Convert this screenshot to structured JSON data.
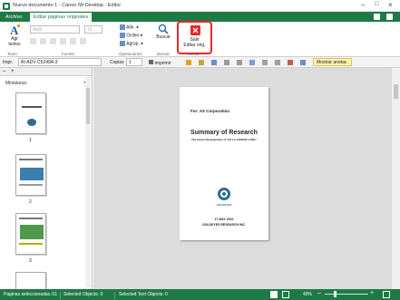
{
  "title": "Nuevo documento 1 - Canon iW Desktop - Editor",
  "tabs": {
    "file": "Archivo",
    "edit": "Editar páginas originales"
  },
  "ribbon": {
    "add_text": "Agr\ntextos",
    "font_placeholder": "Arial",
    "size_placeholder": "10",
    "align": "Alin.",
    "order": "Orden",
    "group": "Agrup.",
    "search": "Buscar",
    "exit": "Salir\nEditar orig.",
    "groups": {
      "text": "Texto",
      "font": "Fuente",
      "operations": "Operaciones",
      "search": "Buscar",
      "close": "Cerrar"
    }
  },
  "quickbar": {
    "printer_label": "Impr.",
    "printer": "iR-ADV C5240A-3",
    "copies_label": "Copias",
    "copies": "1",
    "print": "Imprimir",
    "show_notes": "Mostrar anotac."
  },
  "thumbnails": {
    "title": "Miniaturas",
    "pages": [
      "1",
      "2",
      "3"
    ]
  },
  "document": {
    "for": "For: XX Corporation",
    "heading": "Summary of Research",
    "subheading": "The future Development of \"XX LA CIUDAD LUNA\"",
    "logo": "GOLDEYES",
    "date": "17 MAY 2010",
    "company": "GOLDEYES RESEARCH INC."
  },
  "status": {
    "selected_pages": "Páginas seleccionadas /11",
    "selected_objects": "Selected Objects: 0",
    "selected_text": "Selected Text Objects: 0",
    "zoom": "40%"
  },
  "colors": {
    "accent": "#1e7a45",
    "highlight": "#e8282b"
  }
}
